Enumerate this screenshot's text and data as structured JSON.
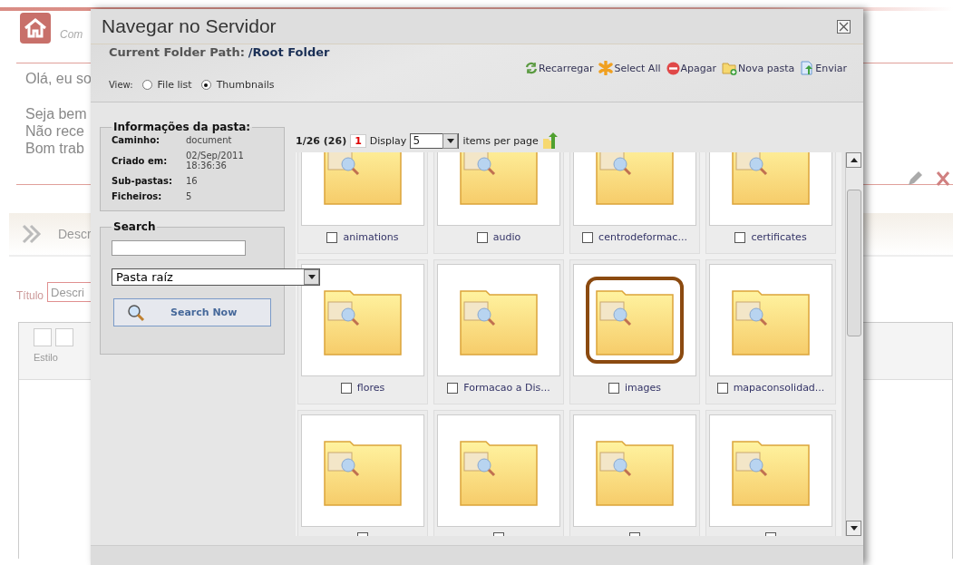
{
  "background_page": {
    "header_text": "Com",
    "greeting": "Olá, eu so",
    "welcome_lines": [
      "Seja bem",
      "Não rece",
      "Bom trab"
    ],
    "section_title": "Descr",
    "title_label": "Título",
    "title_field": {
      "placeholder": "Descri"
    },
    "editor_style_label": "Estilo"
  },
  "dialog": {
    "title": "Navegar no Servidor",
    "path_label": "Current Folder Path:",
    "path_value": "/Root Folder",
    "toolbar": [
      {
        "label": "Recarregar",
        "kind": "reload"
      },
      {
        "label": "Select All",
        "kind": "select"
      },
      {
        "label": "Apagar",
        "kind": "delete"
      },
      {
        "label": "Nova pasta",
        "kind": "newfolder"
      },
      {
        "label": "Enviar",
        "kind": "upload"
      }
    ],
    "view": {
      "label": "View:",
      "options": [
        {
          "label": "File list",
          "selected": false
        },
        {
          "label": "Thumbnails",
          "selected": true
        }
      ]
    },
    "folder_info": {
      "legend": "Informações da pasta:",
      "rows": [
        {
          "key": "Caminho:",
          "value": "document"
        },
        {
          "key": "Criado em:",
          "value": "02/Sep/2011 18:36:36"
        },
        {
          "key": "Sub-pastas:",
          "value": "16"
        },
        {
          "key": "Ficheiros:",
          "value": "5"
        }
      ]
    },
    "search": {
      "legend": "Search",
      "scope": "Pasta raíz",
      "button": "Search Now"
    },
    "pagination": {
      "position": "1/26 (26)",
      "page": "1",
      "display_label": "Display",
      "per_page": "5",
      "suffix": "items per page"
    },
    "items": [
      {
        "label": "animations",
        "checked": false,
        "selected": false
      },
      {
        "label": "audio",
        "checked": false,
        "selected": false
      },
      {
        "label": "centrodeformac...",
        "checked": false,
        "selected": false
      },
      {
        "label": "certificates",
        "checked": false,
        "selected": false
      },
      {
        "label": "flores",
        "checked": false,
        "selected": false
      },
      {
        "label": "Formacao a Dis...",
        "checked": false,
        "selected": false
      },
      {
        "label": "images",
        "checked": false,
        "selected": true
      },
      {
        "label": "mapaconsolidad...",
        "checked": false,
        "selected": false
      },
      {
        "checked": false,
        "selected": false
      },
      {
        "checked": false,
        "selected": false
      },
      {
        "checked": false,
        "selected": false
      },
      {
        "checked": false,
        "selected": false
      }
    ]
  }
}
